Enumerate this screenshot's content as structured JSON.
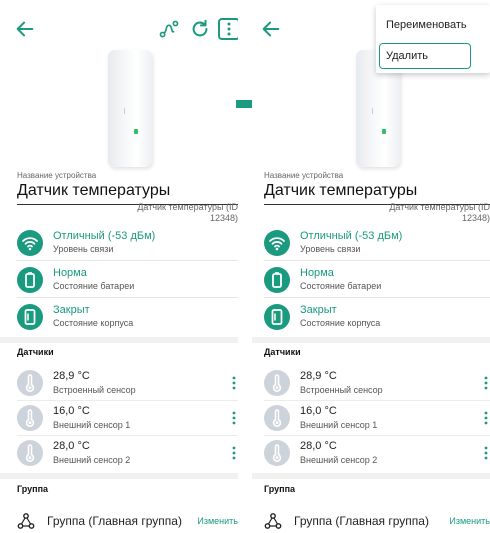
{
  "device_name_caption": "Название устройства",
  "device_name": "Датчик температуры",
  "device_hint": "Датчик температуры (ID 12348)",
  "statuses": [
    {
      "title": "Отличный (-53 дБм)",
      "subtitle": "Уровень связи",
      "icon": "wifi-icon"
    },
    {
      "title": "Норма",
      "subtitle": "Состояние батареи",
      "icon": "battery-icon"
    },
    {
      "title": "Закрыт",
      "subtitle": "Состояние корпуса",
      "icon": "case-icon"
    }
  ],
  "sensors_header": "Датчики",
  "sensors": [
    {
      "value": "28,9 °C",
      "name": "Встроенный сенсор",
      "icon": "thermometer-icon"
    },
    {
      "value": "16,0 °C",
      "name": "Внешний сенсор 1",
      "icon": "thermometer-icon"
    },
    {
      "value": "28,0 °C",
      "name": "Внешний сенсор 2",
      "icon": "thermometer-icon"
    }
  ],
  "group_header": "Группа",
  "group": {
    "label": "Группа (Главная группа)",
    "change": "Изменить"
  },
  "menu": {
    "rename": "Переименовать",
    "delete": "Удалить"
  },
  "colors": {
    "accent": "#1a9a7e",
    "muted_icon": "#cdd3da"
  }
}
